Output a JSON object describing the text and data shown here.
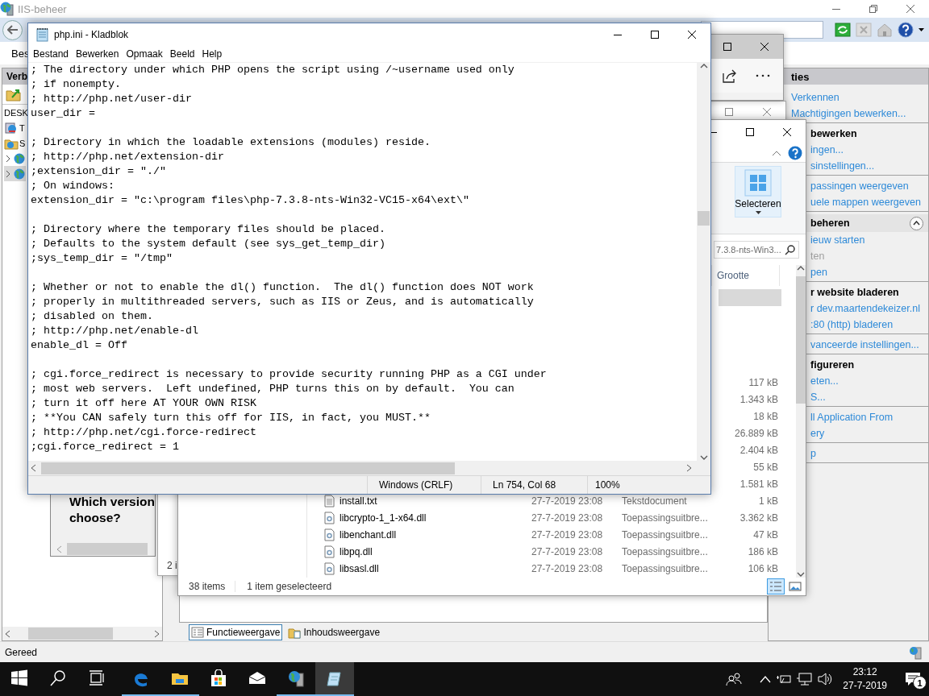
{
  "iis": {
    "title": "IIS-beheer",
    "menu": [
      {
        "label": "Bes"
      }
    ],
    "connections": {
      "header": "Verb",
      "tree": [
        {
          "label": "DESK",
          "selected": false,
          "children": [
            {
              "label": "T",
              "kind": "pool",
              "selected": false
            },
            {
              "label": "S",
              "kind": "sites",
              "selected": false,
              "children": [
                {
                  "kind": "site",
                  "expanded": false,
                  "selected": false
                },
                {
                  "kind": "site",
                  "expanded": false,
                  "selected": true
                }
              ]
            }
          ]
        }
      ]
    },
    "actions": {
      "header": "ties",
      "groups": [
        {
          "items": [
            {
              "text": "Verkennen",
              "disabled": false
            },
            {
              "text": "Machtigingen bewerken...",
              "disabled": false
            }
          ]
        },
        {
          "title": "bewerken",
          "items": [
            {
              "text": "ingen...",
              "disabled": false
            },
            {
              "text": "sinstellingen...",
              "disabled": false
            }
          ]
        },
        {
          "items": [
            {
              "text": "passingen weergeven",
              "disabled": false
            },
            {
              "text": "uele mappen weergeven",
              "disabled": false
            }
          ]
        },
        {
          "title": "beheren",
          "collapsible": true,
          "items": [
            {
              "text": "ieuw starten",
              "disabled": false
            },
            {
              "text": "ten",
              "disabled": true
            },
            {
              "text": "pen",
              "disabled": false
            }
          ]
        },
        {
          "title": "r website bladeren",
          "items": [
            {
              "text": "r dev.maartendekeizer.nl",
              "disabled": false
            },
            {
              "text": ":80 (http) bladeren",
              "disabled": false
            }
          ]
        },
        {
          "items": [
            {
              "text": "vanceerde instellingen...",
              "disabled": false
            }
          ]
        },
        {
          "title": "figureren",
          "items": [
            {
              "text": "eten...",
              "disabled": false
            },
            {
              "text": "S...",
              "disabled": false
            }
          ]
        },
        {
          "items": [
            {
              "text": "ll Application From",
              "disabled": false
            },
            {
              "text": "ery",
              "disabled": false
            }
          ]
        },
        {
          "items": [
            {
              "text": "p",
              "disabled": false
            }
          ]
        }
      ]
    },
    "view_tabs": [
      {
        "label": "Functieweergave",
        "kind": "features",
        "selected": true
      },
      {
        "label": "Inhoudsweergave",
        "kind": "content",
        "selected": false
      }
    ],
    "status": "Gereed"
  },
  "browser_window": {
    "heading": [
      "Which version",
      "choose?"
    ]
  },
  "explorer_back": {
    "status": "2 i"
  },
  "explorer": {
    "ribbon_button": "Selecteren",
    "search": {
      "placeholder": "7.3.8-nts-Win3..."
    },
    "columns": [
      {
        "label": "Grootte"
      }
    ],
    "rows": [
      {
        "selected": true
      },
      {
        "selected": false
      },
      {
        "selected": false
      },
      {
        "selected": false
      },
      {
        "selected": false
      },
      {
        "size": "117 kB",
        "selected": false
      },
      {
        "size": "1.343 kB",
        "selected": false
      },
      {
        "size": "18 kB",
        "selected": false
      },
      {
        "size": "26.889 kB",
        "selected": false
      },
      {
        "size": "2.404 kB",
        "selected": false
      },
      {
        "size": "55 kB",
        "selected": false
      },
      {
        "size": "1.581 kB",
        "selected": false
      },
      {
        "name": "install.txt",
        "kind": "text",
        "date": "27-7-2019 23:08",
        "type": "Tekstdocument",
        "size": "1 kB",
        "selected": false
      },
      {
        "name": "libcrypto-1_1-x64.dll",
        "kind": "dll",
        "date": "27-7-2019 23:08",
        "type": "Toepassingsuitbre...",
        "size": "3.362 kB",
        "selected": false
      },
      {
        "name": "libenchant.dll",
        "kind": "dll",
        "date": "27-7-2019 23:08",
        "type": "Toepassingsuitbre...",
        "size": "47 kB",
        "selected": false
      },
      {
        "name": "libpq.dll",
        "kind": "dll",
        "date": "27-7-2019 23:08",
        "type": "Toepassingsuitbre...",
        "size": "186 kB",
        "selected": false
      },
      {
        "name": "libsasl.dll",
        "kind": "dll",
        "date": "27-7-2019 23:08",
        "type": "Toepassingsuitbre...",
        "size": "106 kB",
        "selected": false
      }
    ],
    "status": {
      "count": "38 items",
      "selection": "1 item geselecteerd"
    },
    "views": [
      {
        "kind": "details",
        "selected": true
      },
      {
        "kind": "large",
        "selected": false
      }
    ]
  },
  "notepad": {
    "title": "php.ini - Kladblok",
    "menu": [
      "Bestand",
      "Bewerken",
      "Opmaak",
      "Beeld",
      "Help"
    ],
    "text": "; The directory under which PHP opens the script using /~username used only\n; if nonempty.\n; http://php.net/user-dir\nuser_dir =\n\n; Directory in which the loadable extensions (modules) reside.\n; http://php.net/extension-dir\n;extension_dir = \"./\"\n; On windows:\nextension_dir = \"c:\\program files\\php-7.3.8-nts-Win32-VC15-x64\\ext\\\"\n\n; Directory where the temporary files should be placed.\n; Defaults to the system default (see sys_get_temp_dir)\n;sys_temp_dir = \"/tmp\"\n\n; Whether or not to enable the dl() function.  The dl() function does NOT work\n; properly in multithreaded servers, such as IIS or Zeus, and is automatically\n; disabled on them.\n; http://php.net/enable-dl\nenable_dl = Off\n\n; cgi.force_redirect is necessary to provide security running PHP as a CGI under\n; most web servers.  Left undefined, PHP turns this on by default.  You can\n; turn it off here AT YOUR OWN RISK\n; **You CAN safely turn this off for IIS, in fact, you MUST.**\n; http://php.net/cgi.force-redirect\n;cgi.force_redirect = 1",
    "status": [
      "Windows (CRLF)",
      "Ln 754, Col 68",
      "100%"
    ]
  },
  "taskbar": {
    "apps": [
      {
        "kind": "edge",
        "running": true,
        "active": false
      },
      {
        "kind": "explorer",
        "running": true,
        "active": false
      },
      {
        "kind": "store",
        "running": false,
        "active": false
      },
      {
        "kind": "mail",
        "running": false,
        "active": false
      },
      {
        "kind": "iis",
        "running": true,
        "active": false
      },
      {
        "kind": "notepad",
        "running": true,
        "active": true
      }
    ],
    "time": "23:12",
    "date": "27-7-2019",
    "notifications": "1"
  }
}
